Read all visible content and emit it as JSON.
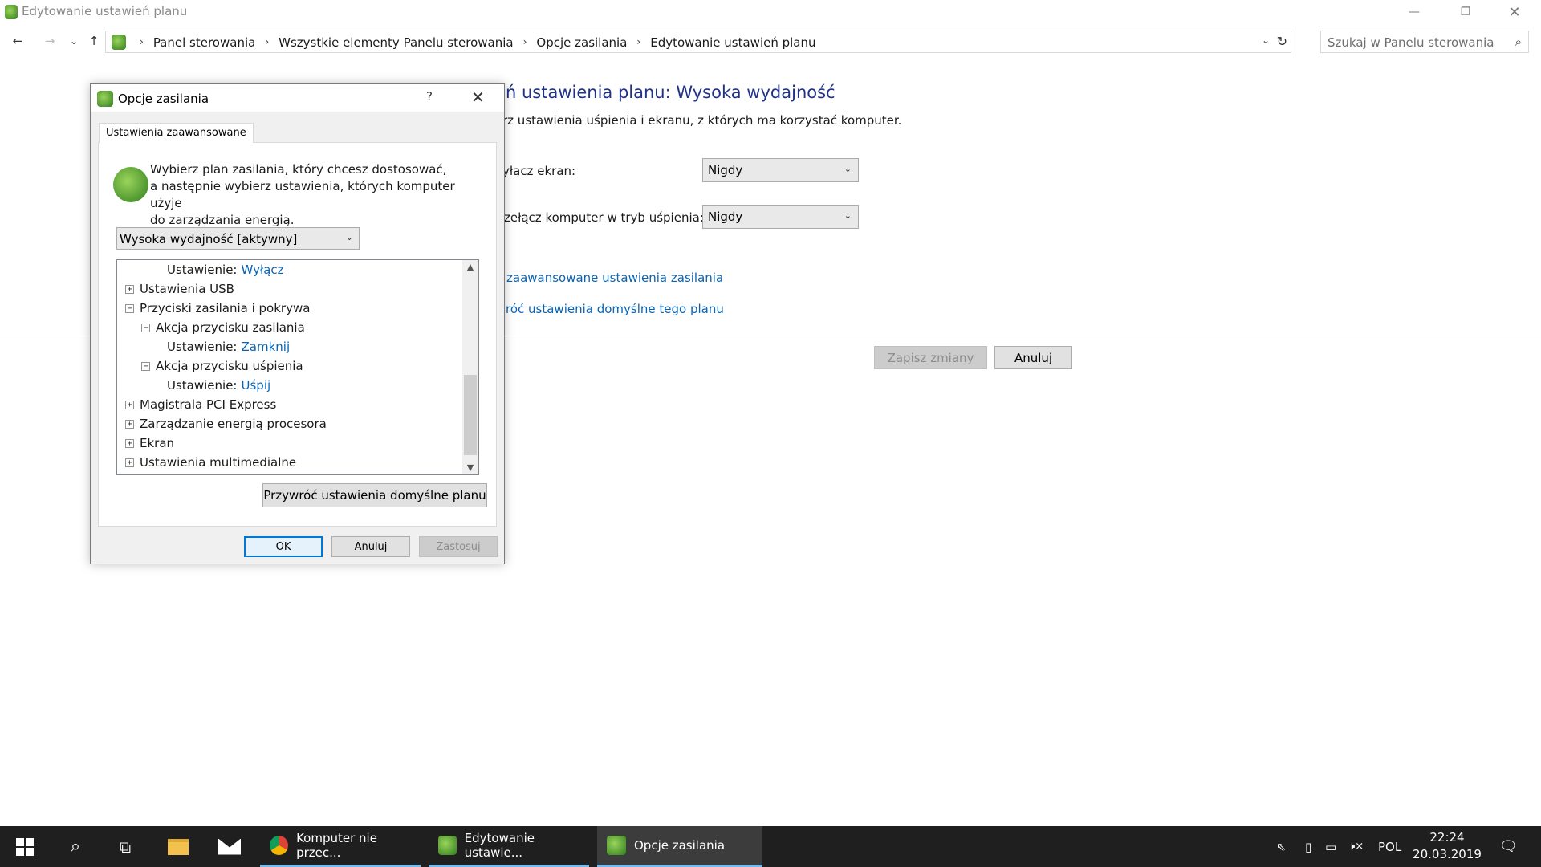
{
  "window": {
    "title": "Edytowanie ustawień planu",
    "minimize": "—",
    "restore": "❐",
    "close": "✕"
  },
  "nav": {
    "back": "←",
    "forward": "→",
    "recent": "⌄",
    "up": "↑",
    "breadcrumbs": [
      "Panel sterowania",
      "Wszystkie elementy Panelu sterowania",
      "Opcje zasilania",
      "Edytowanie ustawień planu"
    ],
    "separator": "›",
    "dropdown": "⌄",
    "refresh": "↻",
    "search_placeholder": "Szukaj w Panelu sterowania",
    "search_icon": "⌕"
  },
  "main": {
    "heading": "ń ustawienia planu: Wysoka wydajność",
    "description": "rz ustawienia uśpienia i ekranu, z których ma korzystać komputer.",
    "screen_label": "yłącz ekran:",
    "screen_value": "Nigdy",
    "sleep_label": "zełącz komputer w tryb uśpienia:",
    "sleep_value": "Nigdy",
    "combo_chevron": "⌄",
    "advanced_link": "zaawansowane ustawienia zasilania",
    "restore_link": "róć ustawienia domyślne tego planu",
    "save_button": "Zapisz zmiany",
    "cancel_button": "Anuluj"
  },
  "dialog": {
    "title": "Opcje zasilania",
    "help": "?",
    "close": "✕",
    "tab": "Ustawienia zaawansowane",
    "intro_line1": "Wybierz plan zasilania, który chcesz dostosować,",
    "intro_line2": "a następnie wybierz ustawienia, których komputer użyje",
    "intro_line3": "do zarządzania energią.",
    "plan_value": "Wysoka wydajność [aktywny]",
    "plan_chevron": "⌄",
    "tree": [
      {
        "indent": 2,
        "expander": "",
        "label": "Ustawienie:",
        "value": "Wyłącz"
      },
      {
        "indent": 0,
        "expander": "+",
        "label": "Ustawienia USB",
        "value": ""
      },
      {
        "indent": 0,
        "expander": "−",
        "label": "Przyciski zasilania i pokrywa",
        "value": ""
      },
      {
        "indent": 1,
        "expander": "−",
        "label": "Akcja przycisku zasilania",
        "value": ""
      },
      {
        "indent": 2,
        "expander": "",
        "label": "Ustawienie:",
        "value": "Zamknij"
      },
      {
        "indent": 1,
        "expander": "−",
        "label": "Akcja przycisku uśpienia",
        "value": ""
      },
      {
        "indent": 2,
        "expander": "",
        "label": "Ustawienie:",
        "value": "Uśpij"
      },
      {
        "indent": 0,
        "expander": "+",
        "label": "Magistrala PCI Express",
        "value": ""
      },
      {
        "indent": 0,
        "expander": "+",
        "label": "Zarządzanie energią procesora",
        "value": ""
      },
      {
        "indent": 0,
        "expander": "+",
        "label": "Ekran",
        "value": ""
      },
      {
        "indent": 0,
        "expander": "+",
        "label": "Ustawienia multimedialne",
        "value": ""
      }
    ],
    "scroll_up": "▲",
    "scroll_down": "▼",
    "restore_button": "Przywróć ustawienia domyślne planu",
    "ok_button": "OK",
    "cancel_button": "Anuluj",
    "apply_button": "Zastosuj"
  },
  "taskbar": {
    "start_icon": "windows-logo",
    "search_glyph": "⌕",
    "taskview_glyph": "⧉",
    "apps": [
      {
        "label": "Komputer nie przec...",
        "active": false
      },
      {
        "label": "Edytowanie ustawie...",
        "active": false
      },
      {
        "label": "Opcje zasilania",
        "active": true
      }
    ],
    "tray": {
      "arrow": "⇖",
      "usb": "▯",
      "network": "▭",
      "volume": "🕨×",
      "lang": "POL",
      "time": "22:24",
      "date": "20.03.2019",
      "notification": "🗨"
    }
  },
  "colors": {
    "link": "#0a64b4",
    "heading": "#1e3287",
    "taskbar": "#1f1f1f",
    "accent": "#76b9ed"
  }
}
